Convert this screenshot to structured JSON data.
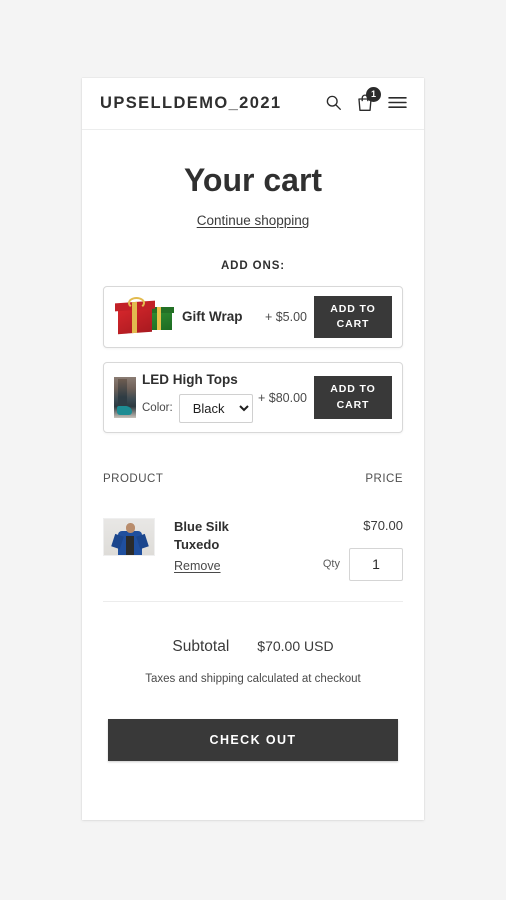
{
  "header": {
    "shop_title": "UPSELLDEMO_2021",
    "search_icon": "search-icon",
    "cart_icon": "shopping-bag-icon",
    "cart_count": "1",
    "menu_icon": "hamburger-menu-icon"
  },
  "cart": {
    "page_title": "Your cart",
    "continue_shopping": "Continue shopping",
    "addons_heading": "ADD ONS:",
    "addons": [
      {
        "name": "Gift Wrap",
        "price": "+ $5.00",
        "button_label": "ADD TO CART",
        "thumb": "gift-wrap-image",
        "has_variant": false
      },
      {
        "name": "LED High Tops",
        "price": "+ $80.00",
        "button_label": "ADD TO CART",
        "thumb": "led-high-tops-image",
        "has_variant": true,
        "variant_label": "Color:",
        "variant_selected": "Black",
        "variant_options": [
          "Black"
        ]
      }
    ],
    "table": {
      "col_product": "PRODUCT",
      "col_price": "PRICE",
      "items": [
        {
          "name": "Blue Silk Tuxedo",
          "remove_label": "Remove",
          "price": "$70.00",
          "qty_label": "Qty",
          "qty_value": "1",
          "thumb": "blue-silk-tuxedo-image"
        }
      ]
    },
    "subtotal_label": "Subtotal",
    "subtotal_value": "$70.00 USD",
    "tax_note": "Taxes and shipping calculated at checkout",
    "checkout_label": "CHECK OUT"
  },
  "colors": {
    "page_background": "#f4f4f4",
    "card_background": "#ffffff",
    "button_dark": "#393939",
    "text_primary": "#2f2f2f",
    "border_light": "#ececec"
  }
}
